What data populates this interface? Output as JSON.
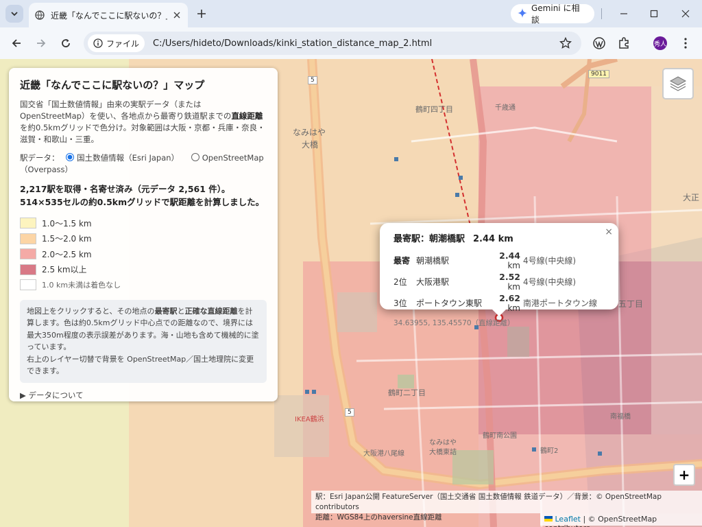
{
  "browser": {
    "tab_title": "近畿「なんでここに駅ないの？」マップ",
    "gemini_label": "Gemini に相談",
    "file_chip": "ファイル",
    "url": "C:/Users/hideto/Downloads/kinki_station_distance_map_2.html",
    "avatar_text": "秀人"
  },
  "panel": {
    "title": "近畿「なんでここに駅ないの？」マップ",
    "desc_1": "国交省「国土数値情報」由来の実駅データ（または OpenStreetMap）を使い、各地点から最寄り鉄道駅までの",
    "desc_bold": "直線距離",
    "desc_2": "を約0.5kmグリッドで色分け。対象範囲は大阪・京都・兵庫・奈良・滋賀・和歌山・三重。",
    "source_label": "駅データ：",
    "source_option_1": "国土数値情報（Esri Japan）",
    "source_option_2": "OpenStreetMap（Overpass）",
    "count_text": "2,217駅を取得・名寄せ済み（元データ 2,561 件）。514×535セルの約0.5kmグリッドで駅距離を計算しました。",
    "legend": [
      {
        "label": "1.0〜1.5 km",
        "color": "#fdf4bf"
      },
      {
        "label": "1.5〜2.0 km",
        "color": "#fcd5a5"
      },
      {
        "label": "2.0〜2.5 km",
        "color": "#f4aaa6"
      },
      {
        "label": "2.5 km以上",
        "color": "#d87986"
      },
      {
        "label": "1.0 km未満は着色なし",
        "color": "#ffffff"
      }
    ],
    "hint_1": "地図上をクリックすると、その地点の",
    "hint_b1": "最寄駅",
    "hint_2": "と",
    "hint_b2": "正確な直線距離",
    "hint_3": "を計算します。色は約0.5kmグリッド中心点での距離なので、境界には最大350m程度の表示誤差があります。海・山地も含めて機械的に塗っています。",
    "hint_4": "右上のレイヤー切替で背景を OpenStreetMap／国土地理院に変更できます。",
    "details_label": "▶ データについて"
  },
  "popup": {
    "head_label": "最寄駅：朝潮橋駅",
    "head_km": "2.44 km",
    "rows": [
      {
        "rank": "最寄",
        "station": "朝潮橋駅",
        "dist": "2.44",
        "unit": "km",
        "line": "4号線(中央線)"
      },
      {
        "rank": "2位",
        "station": "大阪港駅",
        "dist": "2.52",
        "unit": "km",
        "line": "4号線(中央線)"
      },
      {
        "rank": "3位",
        "station": "ポートタウン東駅",
        "dist": "2.62",
        "unit": "km",
        "line": "南港ポートタウン線"
      }
    ],
    "coord": "34.63955, 135.45570（直線距離）",
    "close": "×"
  },
  "map": {
    "labels": {
      "tsurumachi4": "鶴町四丁目",
      "naminoha_ohashi_1": "なみはや",
      "naminoha_ohashi_2": "大橋",
      "route5a": "5",
      "route5b": "5",
      "route9011": "9011",
      "tsurumachi2": "鶴町二丁目",
      "ikea": "IKEA鶴浜",
      "minami_fukuhashi": "南福橋",
      "tsurumachi_minami": "鶴町南公園",
      "osakako8": "大阪港八尾線",
      "tsurumachi_2b": "鶴町2",
      "taisho": "大正",
      "gochome": "五丁目",
      "naminoha_tsuruhama_1": "なみはや",
      "naminoha_tsuruhama_2": "大橋東詰",
      "senbon": "千歳通"
    },
    "zoom_in": "+",
    "attribution_1": "駅：Esri Japan公開 FeatureServer（国土交通省 国土数値情報 鉄道データ）／背景：© OpenStreetMap contributors",
    "attribution_2": "距離：WGS84上のhaversine直線距離",
    "leaflet": "Leaflet",
    "osm": " | © OpenStreetMap contributors"
  }
}
